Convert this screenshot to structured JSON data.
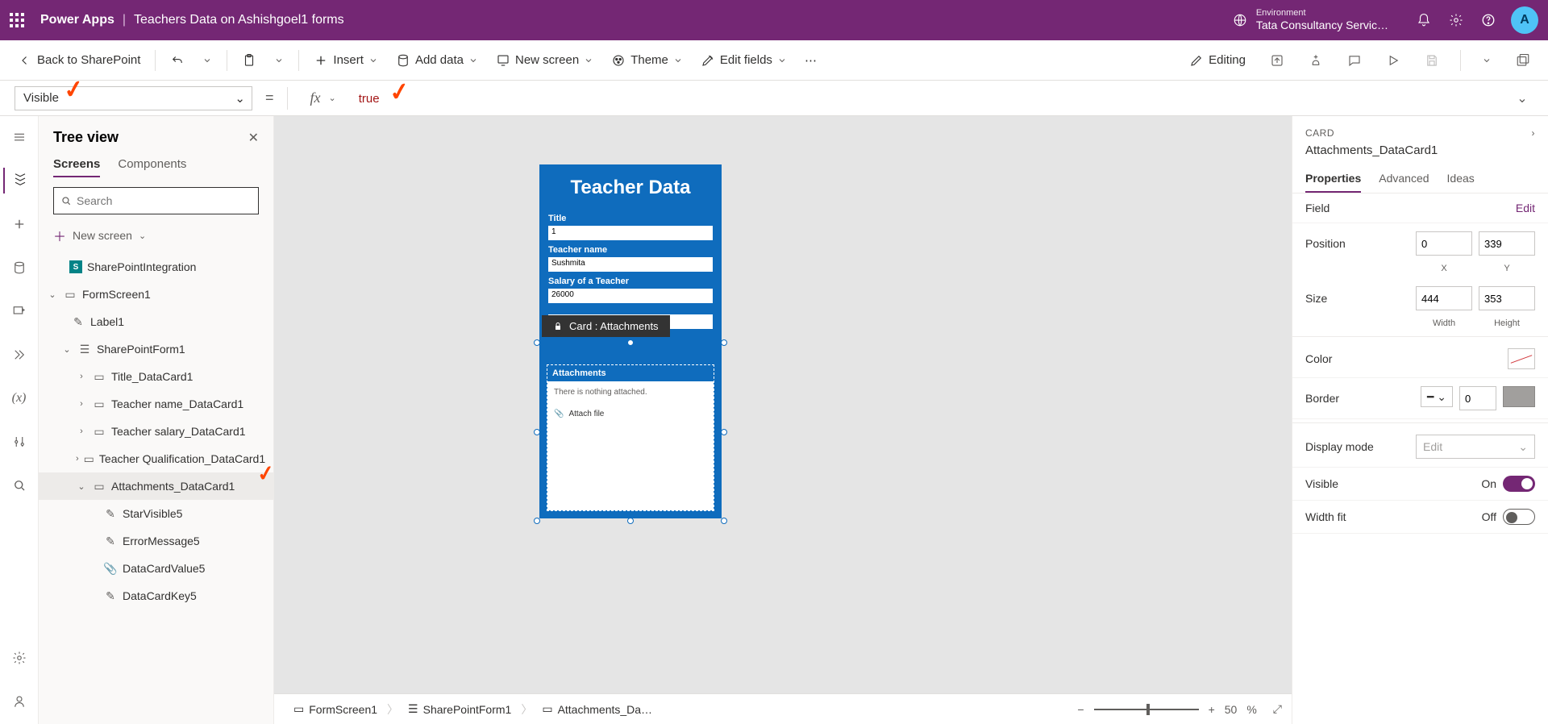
{
  "header": {
    "product": "Power Apps",
    "separator": "|",
    "appName": "Teachers Data on Ashishgoel1 forms",
    "envLabel": "Environment",
    "envName": "Tata Consultancy Servic…",
    "avatar": "A"
  },
  "toolbar": {
    "back": "Back to SharePoint",
    "insert": "Insert",
    "addData": "Add data",
    "newScreen": "New screen",
    "theme": "Theme",
    "editFields": "Edit fields",
    "editing": "Editing"
  },
  "formula": {
    "property": "Visible",
    "value": "true"
  },
  "treeview": {
    "title": "Tree view",
    "tabScreens": "Screens",
    "tabComponents": "Components",
    "searchPlaceholder": "Search",
    "newScreen": "New screen",
    "nodes": {
      "spi": "SharePointIntegration",
      "formscreen": "FormScreen1",
      "label1": "Label1",
      "spform": "SharePointForm1",
      "title_dc": "Title_DataCard1",
      "name_dc": "Teacher name_DataCard1",
      "salary_dc": "Teacher salary_DataCard1",
      "qual_dc": "Teacher Qualification_DataCard1",
      "att_dc": "Attachments_DataCard1",
      "star": "StarVisible5",
      "err": "ErrorMessage5",
      "val": "DataCardValue5",
      "key": "DataCardKey5"
    }
  },
  "canvas": {
    "title": "Teacher Data",
    "f_title": "Title",
    "f_title_v": "1",
    "f_name": "Teacher name",
    "f_name_v": "Sushmita",
    "f_salary": "Salary of a Teacher",
    "f_salary_v": "26000",
    "cardTip": "Card : Attachments",
    "att_label": "Attachments",
    "att_empty": "There is nothing attached.",
    "att_action": "Attach file"
  },
  "breadcrumb": {
    "b1": "FormScreen1",
    "b2": "SharePointForm1",
    "b3": "Attachments_Da…",
    "zoom": "50",
    "zoomUnit": "%"
  },
  "props": {
    "cardLabel": "CARD",
    "cardName": "Attachments_DataCard1",
    "tabProps": "Properties",
    "tabAdv": "Advanced",
    "tabIdeas": "Ideas",
    "field": "Field",
    "edit": "Edit",
    "position": "Position",
    "posX": "0",
    "posY": "339",
    "xLabel": "X",
    "yLabel": "Y",
    "size": "Size",
    "w": "444",
    "h": "353",
    "wLabel": "Width",
    "hLabel": "Height",
    "color": "Color",
    "border": "Border",
    "borderVal": "0",
    "displayMode": "Display mode",
    "displayModeVal": "Edit",
    "visible": "Visible",
    "visibleVal": "On",
    "widthFit": "Width fit",
    "widthFitVal": "Off"
  }
}
